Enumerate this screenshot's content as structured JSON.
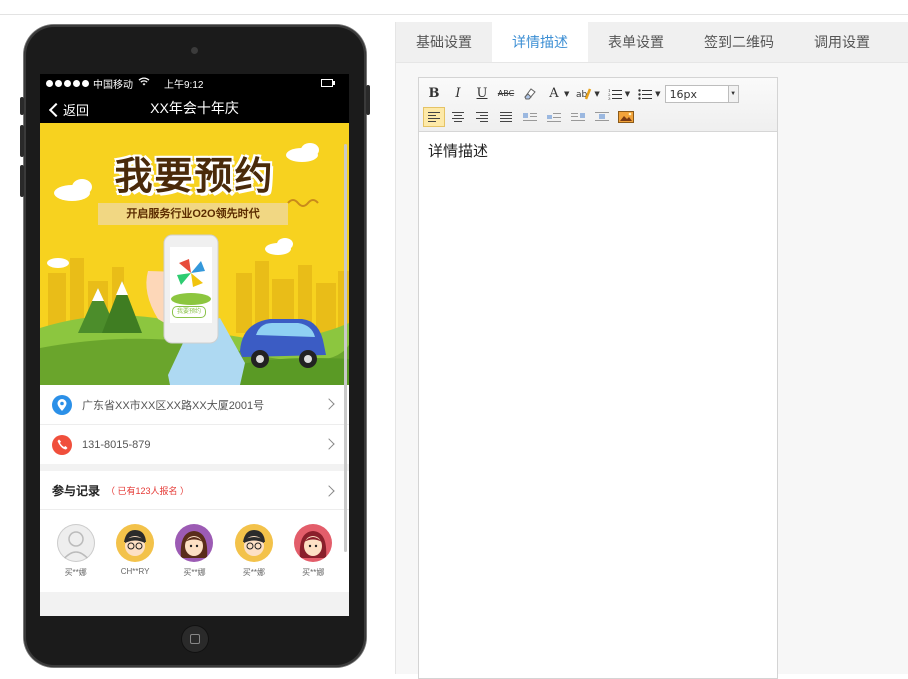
{
  "phone": {
    "status_bar": {
      "carrier": "中国移动",
      "time": "上午9:12"
    },
    "nav": {
      "back_label": "返回",
      "title": "XX年会十年庆"
    },
    "banner": {
      "title": "我要预约",
      "subtitle": "开启服务行业O2O领先时代",
      "button_label": "我要预约"
    },
    "address": "广东省XX市XX区XX路XX大厦2001号",
    "phone_number": "131-8015-879",
    "records": {
      "title": "参与记录",
      "count_label": "（ 已有123人报名 ）",
      "attendees": [
        {
          "name": "买**娜",
          "style": "placeholder"
        },
        {
          "name": "CH**RY",
          "style": "boy"
        },
        {
          "name": "买**娜",
          "style": "girl-purple"
        },
        {
          "name": "买**娜",
          "style": "boy"
        },
        {
          "name": "买**娜",
          "style": "girl-red"
        }
      ]
    }
  },
  "tabs": [
    {
      "label": "基础设置",
      "active": false
    },
    {
      "label": "详情描述",
      "active": true
    },
    {
      "label": "表单设置",
      "active": false
    },
    {
      "label": "签到二维码",
      "active": false
    },
    {
      "label": "调用设置",
      "active": false
    }
  ],
  "editor": {
    "font_size": "16px",
    "content": "详情描述"
  },
  "colors": {
    "accent": "#3d8fd4",
    "banner_yellow": "#f7d21f",
    "location_icon": "#2b90e8",
    "phone_icon": "#f04f3c",
    "count_text": "#e53935"
  }
}
